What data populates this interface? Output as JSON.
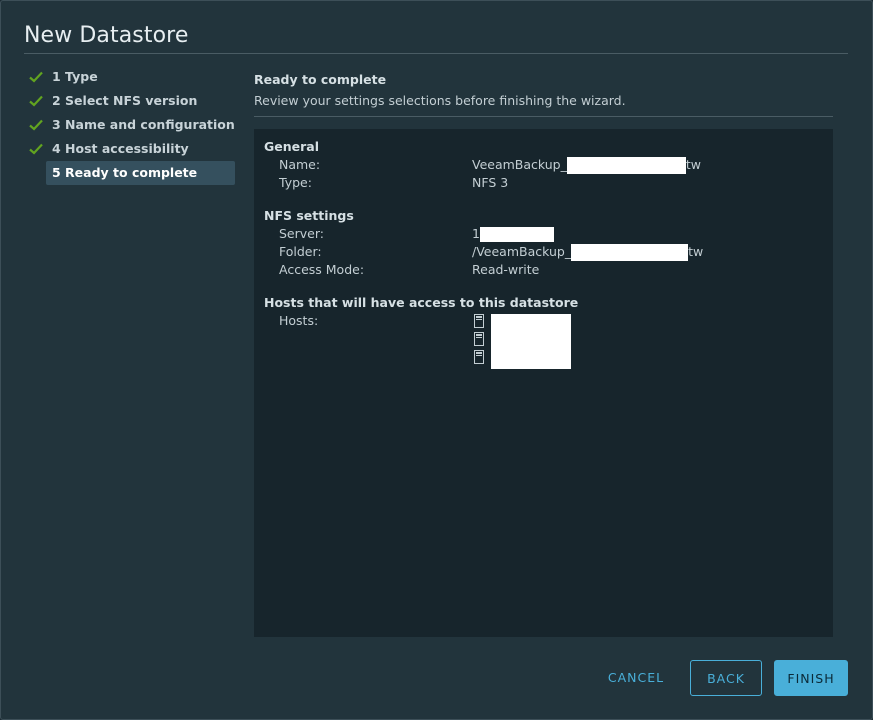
{
  "dialog": {
    "title": "New Datastore"
  },
  "wizard": {
    "steps": [
      {
        "label": "1 Type",
        "done": true
      },
      {
        "label": "2 Select NFS version",
        "done": true
      },
      {
        "label": "3 Name and configuration",
        "done": true
      },
      {
        "label": "4 Host accessibility",
        "done": true
      },
      {
        "label": "5 Ready to complete",
        "done": false,
        "active": true
      }
    ]
  },
  "page": {
    "heading": "Ready to complete",
    "subheading": "Review your settings selections before finishing the wizard."
  },
  "summary": {
    "general": {
      "title": "General",
      "name_label": "Name:",
      "name_prefix": "VeeamBackup_",
      "name_suffix": "tw",
      "type_label": "Type:",
      "type_value": "NFS 3"
    },
    "nfs": {
      "title": "NFS settings",
      "server_label": "Server:",
      "server_prefix": "1",
      "folder_label": "Folder:",
      "folder_prefix": "/VeeamBackup_",
      "folder_suffix": "tw",
      "access_label": "Access Mode:",
      "access_value": "Read-write"
    },
    "hosts": {
      "title": "Hosts that will have access to this datastore",
      "hosts_label": "Hosts:",
      "icons": [
        "host-icon",
        "host-icon",
        "host-icon"
      ]
    }
  },
  "footer": {
    "cancel": "CANCEL",
    "back": "BACK",
    "finish": "FINISH"
  },
  "colors": {
    "accent": "#49afd9",
    "check": "#62a420",
    "dialog_bg": "#22343c",
    "panel_bg": "#17252c"
  }
}
